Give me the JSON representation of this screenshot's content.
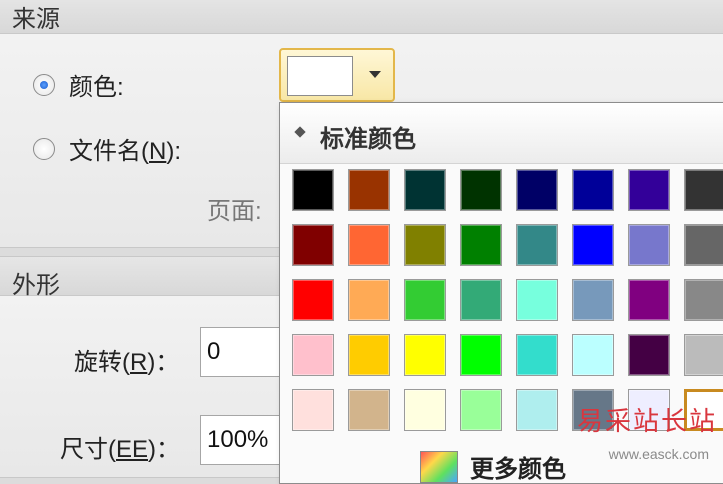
{
  "source_section": {
    "title": "来源",
    "options": [
      {
        "label": "颜色:",
        "selected": true
      },
      {
        "label_prefix": "文件名(",
        "label_key": "N",
        "label_suffix": "):",
        "selected": false
      }
    ],
    "page_label": "页面:",
    "selected_color": "#ffffff"
  },
  "appearance_section": {
    "title": "外形",
    "rotation": {
      "label_prefix": "旋转(",
      "label_key": "R",
      "label_suffix": ")：",
      "value": "0"
    },
    "size": {
      "label_prefix": "尺寸(",
      "label_key": "EE",
      "label_suffix": ")：",
      "value": "100%"
    }
  },
  "color_popup": {
    "title": "标准颜色",
    "more_colors_label": "更多颜色",
    "swatches": [
      [
        "#000000",
        "#993300",
        "#003333",
        "#003300",
        "#000066",
        "#000099",
        "#330099",
        "#333333"
      ],
      [
        "#800000",
        "#ff6633",
        "#808000",
        "#008000",
        "#338888",
        "#0000ff",
        "#7777cc",
        "#666666"
      ],
      [
        "#ff0000",
        "#ffaa55",
        "#33cc33",
        "#33aa77",
        "#77ffdd",
        "#7799bb",
        "#800080",
        "#888888"
      ],
      [
        "#ffc0cc",
        "#ffcc00",
        "#ffff00",
        "#00ff00",
        "#33ddcc",
        "#bbffff",
        "#440044",
        "#bbbbbb"
      ],
      [
        "#ffe0dd",
        "#d2b48c",
        "#ffffe0",
        "#99ff99",
        "#afeeee",
        "#667788",
        "#eeeeff",
        "#ffffff"
      ]
    ],
    "selected_swatch": {
      "row": 4,
      "col": 7
    }
  },
  "watermark": {
    "text": "易采站长站",
    "url": "www.easck.com"
  }
}
